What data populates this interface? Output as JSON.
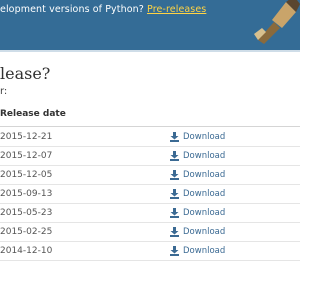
{
  "banner": {
    "text": "elopment versions of Python?",
    "link_label": "Pre-releases"
  },
  "section": {
    "heading": "lease?",
    "subheading": "r:"
  },
  "table": {
    "column_header": "Release date",
    "rows": [
      {
        "date": "2015-12-21",
        "download_label": "Download"
      },
      {
        "date": "2015-12-07",
        "download_label": "Download"
      },
      {
        "date": "2015-12-05",
        "download_label": "Download"
      },
      {
        "date": "2015-09-13",
        "download_label": "Download"
      },
      {
        "date": "2015-05-23",
        "download_label": "Download"
      },
      {
        "date": "2015-02-25",
        "download_label": "Download"
      },
      {
        "date": "2014-12-10",
        "download_label": "Download"
      }
    ]
  },
  "colors": {
    "banner_bg": "#346c96",
    "link_yellow": "#ffd343",
    "download_blue": "#3b6a93"
  }
}
